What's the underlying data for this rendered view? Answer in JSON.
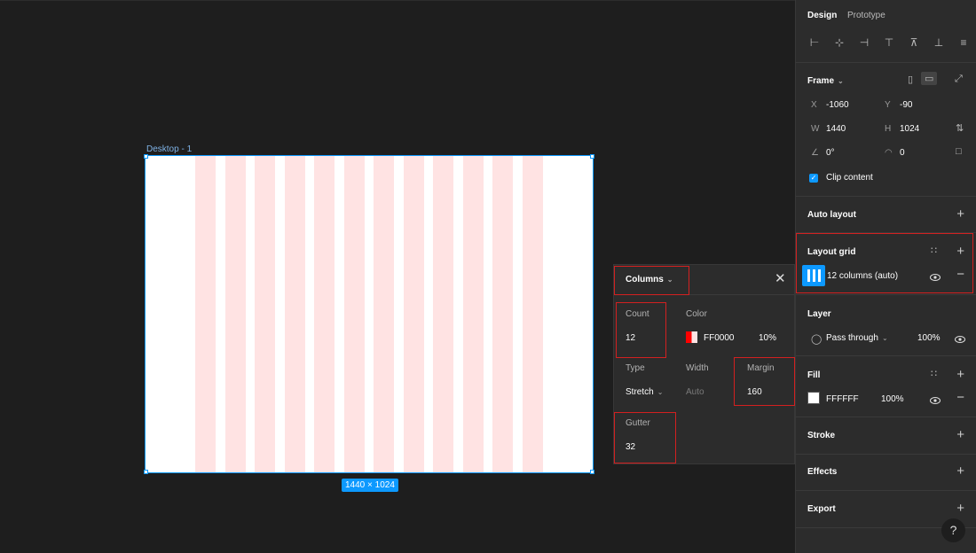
{
  "canvas": {
    "frame_label": "Desktop - 1",
    "size_badge": "1440 × 1024"
  },
  "popup": {
    "title": "Columns",
    "count_label": "Count",
    "count_value": "12",
    "color_label": "Color",
    "color_value": "FF0000",
    "opacity_value": "10%",
    "type_label": "Type",
    "type_value": "Stretch",
    "width_label": "Width",
    "width_value": "Auto",
    "margin_label": "Margin",
    "margin_value": "160",
    "gutter_label": "Gutter",
    "gutter_value": "32"
  },
  "panel": {
    "tabs": [
      "Design",
      "Prototype"
    ],
    "frame": {
      "title": "Frame",
      "x_label": "X",
      "x_value": "-1060",
      "y_label": "Y",
      "y_value": "-90",
      "w_label": "W",
      "w_value": "1440",
      "h_label": "H",
      "h_value": "1024",
      "rotation_value": "0°",
      "radius_value": "0",
      "clip_label": "Clip content"
    },
    "auto_layout": "Auto layout",
    "layout_grid": {
      "title": "Layout grid",
      "item_label": "12 columns (auto)"
    },
    "layer": {
      "title": "Layer",
      "blend_value": "Pass through",
      "opacity_value": "100%"
    },
    "fill": {
      "title": "Fill",
      "color_value": "FFFFFF",
      "opacity_value": "100%"
    },
    "stroke": "Stroke",
    "effects": "Effects",
    "export": "Export"
  },
  "colors": {
    "accent": "#0d99ff",
    "grid_column": "#ffe3e3",
    "highlight": "#d32020"
  },
  "help_label": "?"
}
